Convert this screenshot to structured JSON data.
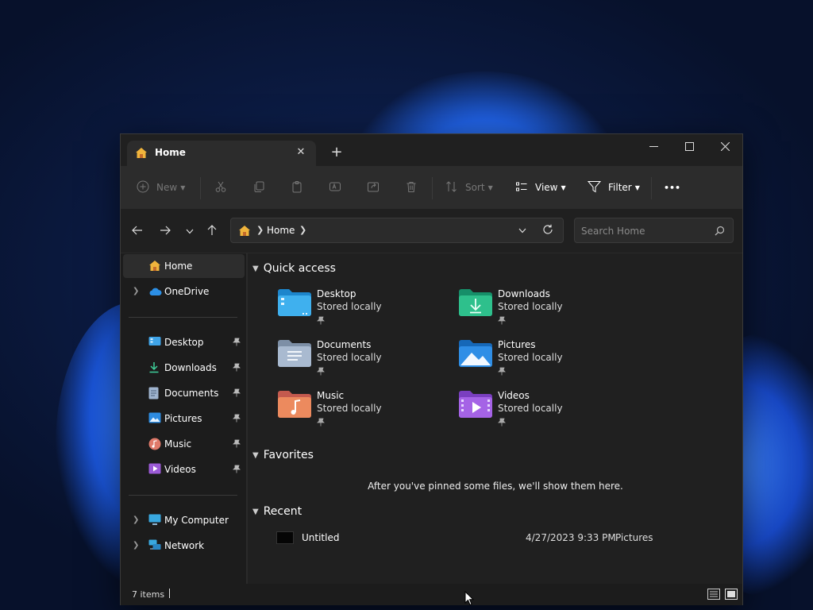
{
  "window": {
    "tab_title": "Home",
    "controls": {
      "minimize": "—",
      "maximize": "☐",
      "close": "✕"
    }
  },
  "toolbar": {
    "new_label": "New",
    "sort_label": "Sort",
    "view_label": "View",
    "filter_label": "Filter",
    "more_label": "•••"
  },
  "address": {
    "path": "Home",
    "search_placeholder": "Search Home"
  },
  "sidebar": {
    "items": [
      {
        "label": "Home",
        "icon": "home-icon"
      },
      {
        "label": "OneDrive",
        "icon": "onedrive-icon"
      },
      {
        "label": "Desktop",
        "icon": "desktop-folder-icon",
        "pinned": true
      },
      {
        "label": "Downloads",
        "icon": "downloads-folder-icon",
        "pinned": true
      },
      {
        "label": "Documents",
        "icon": "documents-folder-icon",
        "pinned": true
      },
      {
        "label": "Pictures",
        "icon": "pictures-folder-icon",
        "pinned": true
      },
      {
        "label": "Music",
        "icon": "music-folder-icon",
        "pinned": true
      },
      {
        "label": "Videos",
        "icon": "videos-folder-icon",
        "pinned": true
      },
      {
        "label": "My Computer",
        "icon": "computer-icon"
      },
      {
        "label": "Network",
        "icon": "network-icon"
      }
    ]
  },
  "quick_access": {
    "title": "Quick access",
    "items": [
      {
        "name": "Desktop",
        "status": "Stored locally"
      },
      {
        "name": "Downloads",
        "status": "Stored locally"
      },
      {
        "name": "Documents",
        "status": "Stored locally"
      },
      {
        "name": "Pictures",
        "status": "Stored locally"
      },
      {
        "name": "Music",
        "status": "Stored locally"
      },
      {
        "name": "Videos",
        "status": "Stored locally"
      }
    ]
  },
  "favorites": {
    "title": "Favorites",
    "empty_message": "After you've pinned some files, we'll show them here."
  },
  "recent": {
    "title": "Recent",
    "items": [
      {
        "name": "Untitled",
        "date": "4/27/2023 9:33 PM",
        "location": "Pictures"
      }
    ]
  },
  "status": {
    "count": "7 items"
  },
  "colors": {
    "accent": "#4cc2ff",
    "window_bg": "#202020",
    "toolbar_bg": "#2c2c2c"
  }
}
